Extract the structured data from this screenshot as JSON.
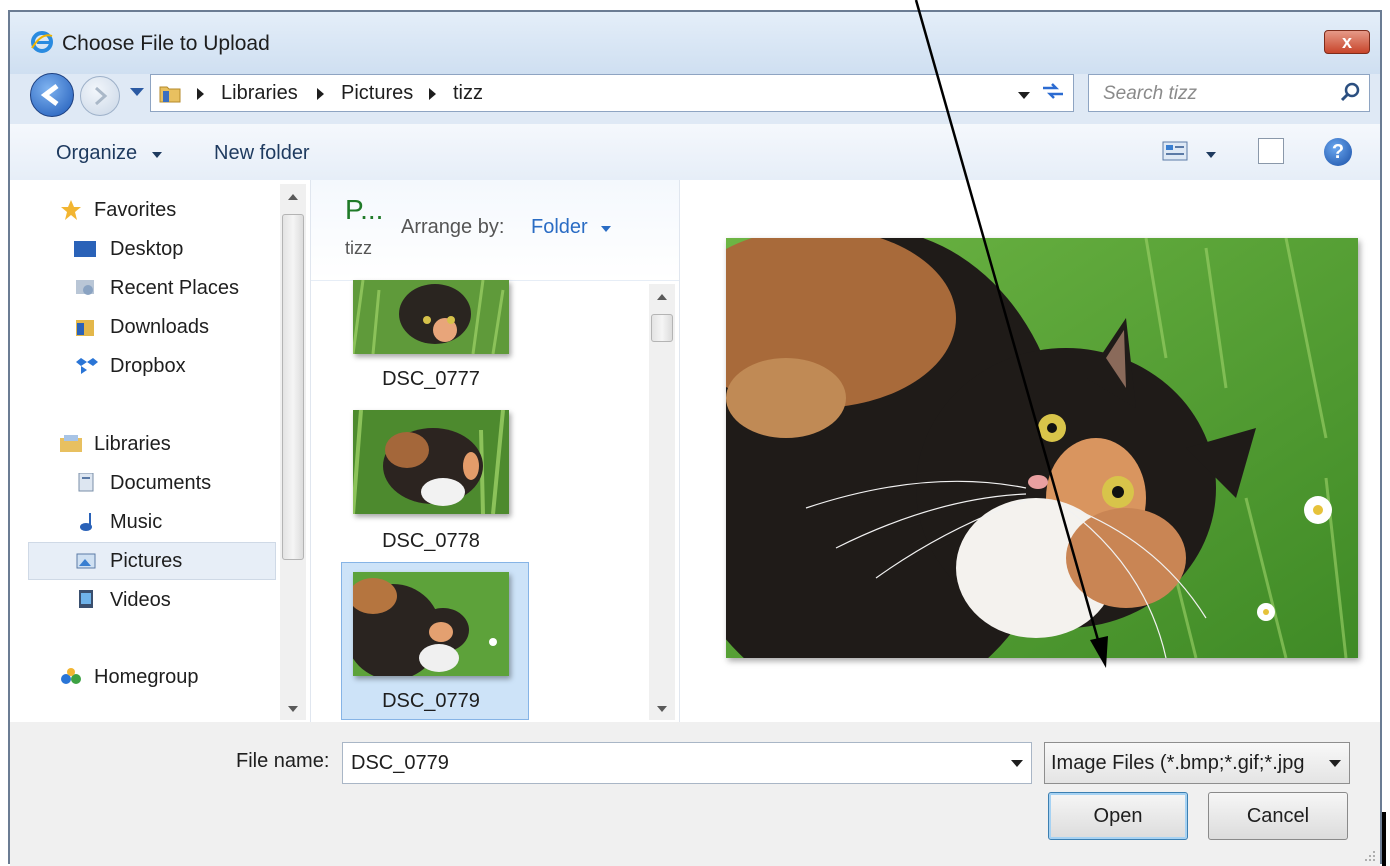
{
  "window": {
    "title": "Choose File to Upload",
    "close_label": "x"
  },
  "address": {
    "breadcrumbs": [
      "Libraries",
      "Pictures",
      "tizz"
    ]
  },
  "search": {
    "placeholder": "Search tizz"
  },
  "toolbar": {
    "organize_label": "Organize",
    "new_folder_label": "New folder",
    "help_label": "?"
  },
  "sidebar": {
    "favorites_header": "Favorites",
    "favorites": [
      {
        "label": "Desktop",
        "icon": "desktop-icon"
      },
      {
        "label": "Recent Places",
        "icon": "recent-places-icon"
      },
      {
        "label": "Downloads",
        "icon": "downloads-icon"
      },
      {
        "label": "Dropbox",
        "icon": "dropbox-icon"
      }
    ],
    "libraries_header": "Libraries",
    "libraries": [
      {
        "label": "Documents",
        "icon": "documents-icon"
      },
      {
        "label": "Music",
        "icon": "music-icon"
      },
      {
        "label": "Pictures",
        "icon": "pictures-icon",
        "selected": true
      },
      {
        "label": "Videos",
        "icon": "videos-icon"
      }
    ],
    "homegroup_label": "Homegroup"
  },
  "library_header": {
    "title": "P...",
    "subtitle": "tizz",
    "arrange_label": "Arrange by:",
    "arrange_value": "Folder"
  },
  "files": [
    {
      "name": "DSC_0777"
    },
    {
      "name": "DSC_0778"
    },
    {
      "name": "DSC_0779",
      "selected": true
    }
  ],
  "bottom": {
    "file_name_label": "File name:",
    "file_name_value": "DSC_0779",
    "filter_value": "Image Files (*.bmp;*.gif;*.jpg",
    "open_label": "Open",
    "cancel_label": "Cancel"
  },
  "colors": {
    "accent": "#2a6cc4",
    "library_title": "#1f7a28",
    "selection": "#cde3f8"
  }
}
